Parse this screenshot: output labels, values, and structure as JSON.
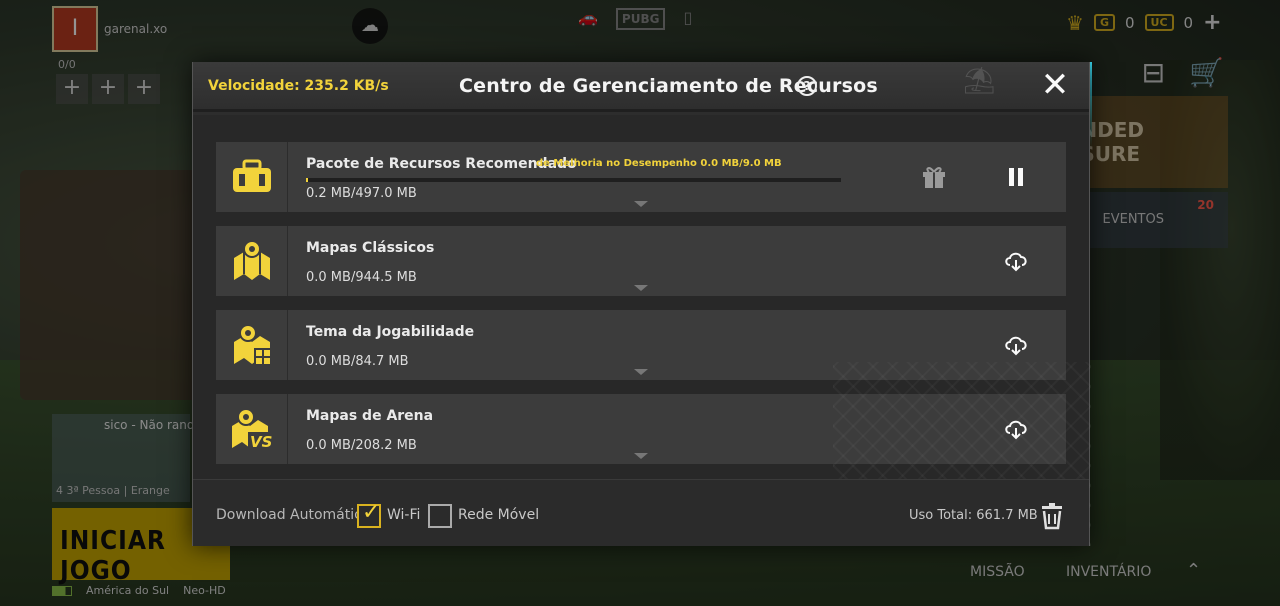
{
  "background": {
    "player_name": "garenal.xo",
    "avatar_letter": "I",
    "squad_count": "0/0",
    "add_slots": [
      "+",
      "+",
      "+"
    ],
    "pubg_logo": "PUBG",
    "currency": {
      "g_badge": "G",
      "g_amount": "0",
      "uc_badge": "UC",
      "uc_amount": "0",
      "add": "+"
    },
    "banner_text": "NDED\nSURE",
    "events_label": "EVENTOS",
    "events_badge": "20",
    "mode_title": "sico - Não ranq",
    "mode_sub": "4 3ª Pessoa | Erange",
    "start_button": "INICIAR JOGO",
    "region": "América do Sul",
    "quality": "Neo-HD",
    "missao": "MISSÃO",
    "inventario": "INVENTÁRIO"
  },
  "modal": {
    "speed": "Velocidade: 235.2 KB/s",
    "title": "Centro de Gerenciamento de Recursos",
    "help_glyph": "?",
    "close_glyph": "✕",
    "rows": [
      {
        "title": "Pacote de Recursos Recomendado",
        "note": "de Melhoria no Desempenho 0.0 MB/9.0 MB",
        "size": "0.2 MB/497.0 MB",
        "icon": "resource-pack-icon",
        "action": "pause",
        "progress": 0.0004
      },
      {
        "title": "Mapas Clássicos",
        "size": "0.0 MB/944.5 MB",
        "icon": "classic-maps-icon",
        "action": "download"
      },
      {
        "title": "Tema da Jogabilidade",
        "size": "0.0 MB/84.7 MB",
        "icon": "gameplay-theme-icon",
        "action": "download"
      },
      {
        "title": "Mapas de Arena",
        "size": "0.0 MB/208.2 MB",
        "icon": "arena-maps-icon",
        "action": "download"
      }
    ],
    "footer": {
      "auto_download_label": "Download Automático",
      "wifi_label": "Wi-Fi",
      "wifi_checked": true,
      "mobile_label": "Rede Móvel",
      "mobile_checked": false,
      "total_usage": "Uso Total: 661.7 MB"
    },
    "colors": {
      "accent": "#f2d33b",
      "row_bg": "#3c3c3c",
      "modal_bg": "#2d2d2d"
    }
  }
}
